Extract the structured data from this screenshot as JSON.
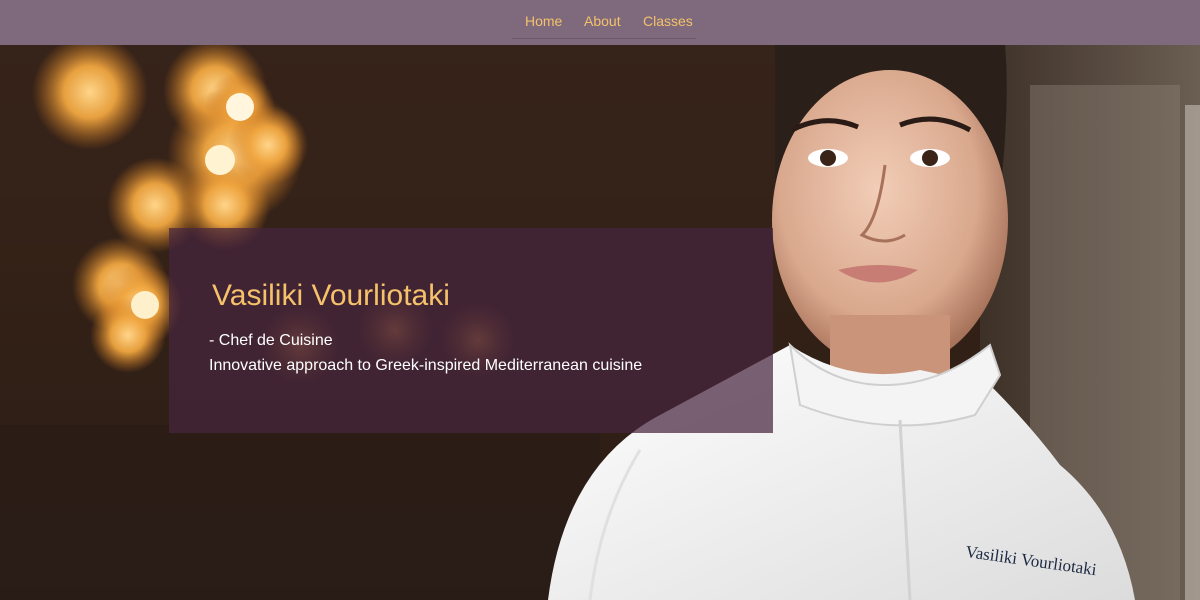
{
  "nav": {
    "items": [
      {
        "label": "Home"
      },
      {
        "label": "About"
      },
      {
        "label": "Classes"
      }
    ],
    "background": "#7e6a7c",
    "link_color": "#f4c16a"
  },
  "hero": {
    "name": "Vasiliki Vourliotaki",
    "role": "- Chef de Cuisine",
    "tagline": "Innovative approach to Greek-inspired Mediterranean cuisine",
    "jacket_embroidery": "Vasiliki Vourliotaki",
    "name_color": "#f5c26b",
    "panel_color": "#46263e"
  }
}
